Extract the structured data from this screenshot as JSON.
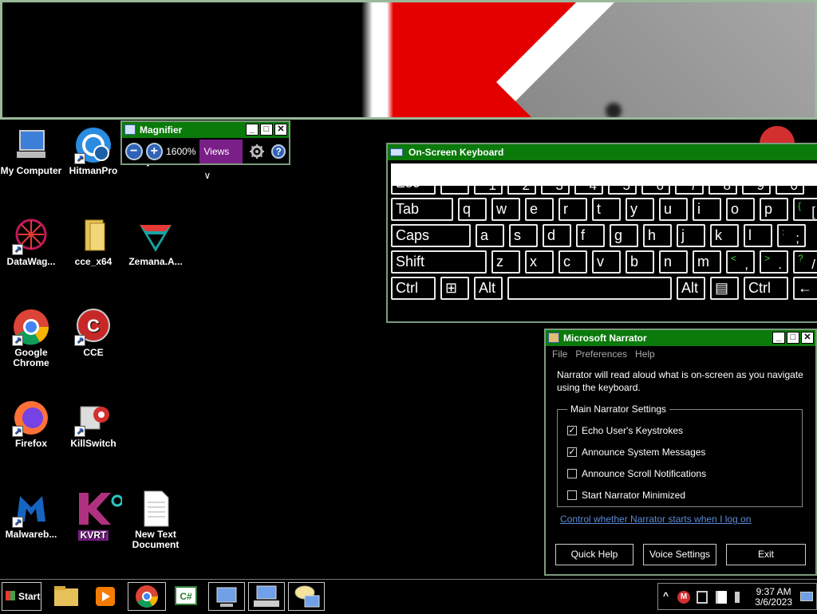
{
  "desktop_icons": [
    {
      "id": "my-computer",
      "label": "My Computer"
    },
    {
      "id": "hitmanpro",
      "label": "HitmanPro"
    },
    {
      "id": "skynews",
      "label": "skynews"
    },
    {
      "id": "datawag",
      "label": "DataWag..."
    },
    {
      "id": "cce-x64",
      "label": "cce_x64"
    },
    {
      "id": "zemana",
      "label": "Zemana.A..."
    },
    {
      "id": "chrome",
      "label": "Google\nChrome"
    },
    {
      "id": "cce",
      "label": "CCE"
    },
    {
      "id": "firefox",
      "label": "Firefox"
    },
    {
      "id": "killswitch",
      "label": "KillSwitch"
    },
    {
      "id": "malwarebytes",
      "label": "Malwareb..."
    },
    {
      "id": "kvrt",
      "label": "KVRT"
    },
    {
      "id": "new-text",
      "label": "New Text\nDocument"
    }
  ],
  "magnifier": {
    "title": "Magnifier",
    "minus": "−",
    "plus": "+",
    "zoom": "1600%",
    "views": "Views",
    "views_chevron": "∨",
    "settings_icon": "gear-icon",
    "help": "?"
  },
  "osk": {
    "title": "On-Screen Keyboard",
    "rows": [
      [
        {
          "m": "Esc"
        },
        {
          "s": "~",
          "m": "`"
        },
        {
          "s": "!",
          "m": "1"
        },
        {
          "s": "@",
          "m": "2"
        },
        {
          "s": "#",
          "m": "3"
        },
        {
          "s": "$",
          "m": "4"
        },
        {
          "s": "%",
          "m": "5"
        },
        {
          "s": "^",
          "m": "6"
        },
        {
          "s": "&",
          "m": "7"
        },
        {
          "s": "*",
          "m": "8"
        },
        {
          "s": "(",
          "m": "9"
        },
        {
          "s": ")",
          "m": "0"
        }
      ],
      [
        {
          "m": "Tab"
        },
        {
          "m": "q"
        },
        {
          "m": "w"
        },
        {
          "m": "e"
        },
        {
          "m": "r"
        },
        {
          "m": "t"
        },
        {
          "m": "y"
        },
        {
          "m": "u"
        },
        {
          "m": "i"
        },
        {
          "m": "o"
        },
        {
          "m": "p"
        },
        {
          "s": "{",
          "m": "["
        }
      ],
      [
        {
          "m": "Caps"
        },
        {
          "m": "a"
        },
        {
          "m": "s"
        },
        {
          "m": "d"
        },
        {
          "m": "f"
        },
        {
          "m": "g"
        },
        {
          "m": "h"
        },
        {
          "m": "j"
        },
        {
          "m": "k"
        },
        {
          "m": "l"
        },
        {
          "s": ":",
          "m": ";"
        },
        {
          "s": "\"",
          "m": ""
        }
      ],
      [
        {
          "m": "Shift"
        },
        {
          "m": "z"
        },
        {
          "m": "x"
        },
        {
          "m": "c"
        },
        {
          "m": "v"
        },
        {
          "m": "b"
        },
        {
          "m": "n"
        },
        {
          "m": "m"
        },
        {
          "s": "<",
          "m": ","
        },
        {
          "s": ">",
          "m": "."
        },
        {
          "s": "?",
          "m": "/"
        }
      ],
      [
        {
          "m": "Ctrl"
        },
        {
          "m": "⊞"
        },
        {
          "m": "Alt"
        },
        {
          "m": ""
        },
        {
          "m": "Alt"
        },
        {
          "m": "▤"
        },
        {
          "m": "Ctrl"
        },
        {
          "m": "←"
        }
      ]
    ]
  },
  "narrator": {
    "title": "Microsoft Narrator",
    "menu": [
      "File",
      "Preferences",
      "Help"
    ],
    "description": "Narrator will read aloud what is on-screen as you navigate using the keyboard.",
    "group": "Main Narrator Settings",
    "options": [
      {
        "label": "Echo User's Keystrokes",
        "checked": true
      },
      {
        "label": "Announce System Messages",
        "checked": true
      },
      {
        "label": "Announce Scroll Notifications",
        "checked": false
      },
      {
        "label": "Start Narrator Minimized",
        "checked": false
      }
    ],
    "check_mark": "✓",
    "link": "Control whether Narrator starts when I log on",
    "buttons": [
      "Quick Help",
      "Voice Settings",
      "Exit"
    ]
  },
  "window_buttons": {
    "min": "_",
    "max": "□",
    "close": "✕"
  },
  "taskbar": {
    "start": "Start",
    "tray_chevron": "^",
    "time": "9:37 AM",
    "date": "3/6/2023",
    "tray_letter": "M"
  }
}
